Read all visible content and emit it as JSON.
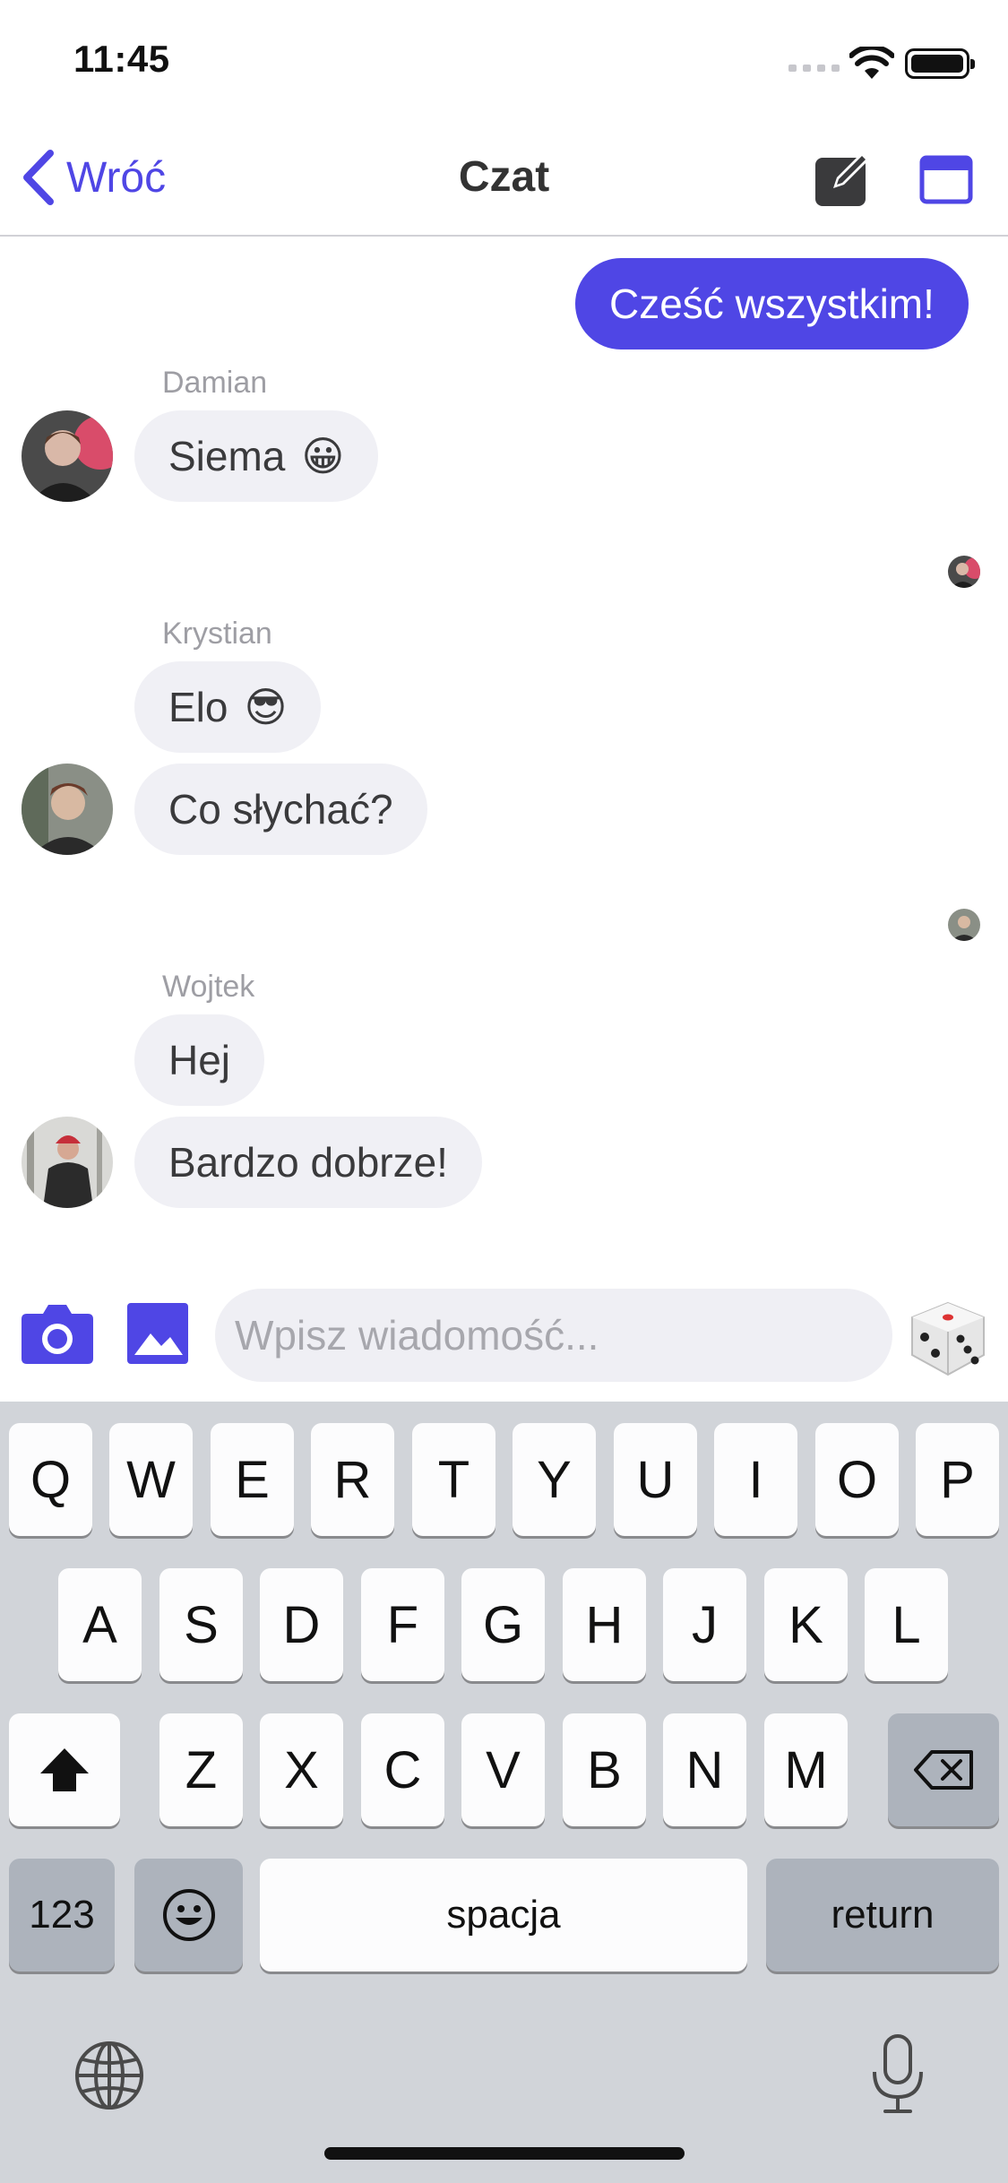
{
  "status_bar": {
    "time": "11:45"
  },
  "nav": {
    "back_label": "Wróć",
    "title": "Czat",
    "accent": "#4f46e5"
  },
  "messages": {
    "own_1": "Cześć wszystkim!",
    "damian": {
      "name": "Damian",
      "text": "Siema",
      "emoji": "😀"
    },
    "krystian": {
      "name": "Krystian",
      "text_1": "Elo",
      "emoji": "😎",
      "text_2": "Co słychać?"
    },
    "wojtek": {
      "name": "Wojtek",
      "text_1": "Hej",
      "text_2": "Bardzo dobrze!"
    }
  },
  "composer": {
    "placeholder": "Wpisz wiadomość..."
  },
  "keyboard": {
    "row1": [
      "Q",
      "W",
      "E",
      "R",
      "T",
      "Y",
      "U",
      "I",
      "O",
      "P"
    ],
    "row2": [
      "A",
      "S",
      "D",
      "F",
      "G",
      "H",
      "J",
      "K",
      "L"
    ],
    "row3": [
      "Z",
      "X",
      "C",
      "V",
      "B",
      "N",
      "M"
    ],
    "numbers_label": "123",
    "space_label": "spacja",
    "return_label": "return"
  },
  "icons": [
    "back-chevron-icon",
    "compose-icon",
    "calendar-icon",
    "camera-icon",
    "image-icon",
    "dice-icon",
    "shift-icon",
    "backspace-icon",
    "emoji-icon",
    "globe-icon",
    "microphone-icon"
  ]
}
